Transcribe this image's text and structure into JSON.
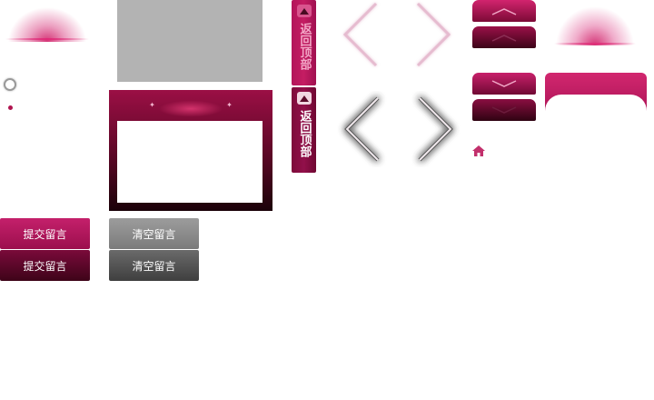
{
  "backtop": {
    "label_normal": "返回顶部",
    "label_hover": "返回顶部"
  },
  "buttons": {
    "submit_normal": "提交留言",
    "submit_hover": "提交留言",
    "clear_normal": "清空留言",
    "clear_hover": "清空留言"
  },
  "icons": {
    "arrow_prev": "chevron-left-icon",
    "arrow_next": "chevron-right-icon",
    "scroll_up": "chevron-up-icon",
    "scroll_down": "chevron-down-icon",
    "home": "home-icon",
    "back_to_top": "triangle-up-icon"
  },
  "colors": {
    "brand": "#b0144f",
    "brand_light": "#d2276f",
    "brand_dark": "#3e0419",
    "neutral": "#8a8a8a"
  }
}
